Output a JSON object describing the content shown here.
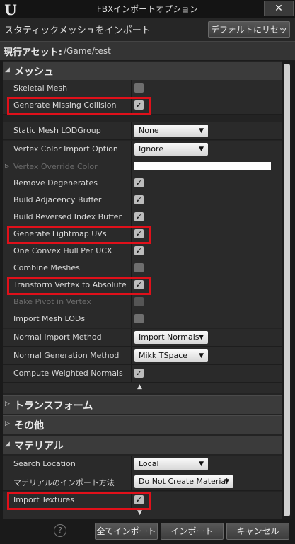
{
  "window": {
    "title": "FBXインポートオプション",
    "close": "✕",
    "logo_icon": "unreal-logo"
  },
  "header": {
    "title": "スタティックメッシュをインポート",
    "reset_label": "デフォルトにリセット"
  },
  "path": {
    "label": "現行アセット:",
    "value": "/Game/test"
  },
  "sections": {
    "mesh": "メッシュ",
    "transform": "トランスフォーム",
    "misc": "その他",
    "material": "マテリアル"
  },
  "mesh_rows": {
    "skeletal_mesh": {
      "label": "Skeletal Mesh",
      "checked": false
    },
    "generate_missing_collision": {
      "label": "Generate Missing Collision",
      "checked": true
    },
    "static_mesh_lodgroup": {
      "label": "Static Mesh LODGroup",
      "value": "None"
    },
    "vertex_color_import_option": {
      "label": "Vertex Color Import Option",
      "value": "Ignore"
    },
    "vertex_override_color": {
      "label": "Vertex Override Color",
      "color": "#ffffff"
    },
    "remove_degenerates": {
      "label": "Remove Degenerates",
      "checked": true
    },
    "build_adjacency_buffer": {
      "label": "Build Adjacency Buffer",
      "checked": true
    },
    "build_reversed_index_buffer": {
      "label": "Build Reversed Index Buffer",
      "checked": true
    },
    "generate_lightmap_uvs": {
      "label": "Generate Lightmap UVs",
      "checked": true
    },
    "one_convex_hull_per_ucx": {
      "label": "One Convex Hull Per UCX",
      "checked": true
    },
    "combine_meshes": {
      "label": "Combine Meshes",
      "checked": false
    },
    "transform_vertex_to_absolute": {
      "label": "Transform Vertex to Absolute",
      "checked": true
    },
    "bake_pivot_in_vertex": {
      "label": "Bake Pivot in Vertex",
      "checked": false
    },
    "import_mesh_lods": {
      "label": "Import Mesh LODs",
      "checked": false
    },
    "normal_import_method": {
      "label": "Normal Import Method",
      "value": "Import Normals"
    },
    "normal_generation_method": {
      "label": "Normal Generation Method",
      "value": "Mikk TSpace"
    },
    "compute_weighted_normals": {
      "label": "Compute Weighted Normals",
      "checked": true
    }
  },
  "material_rows": {
    "search_location": {
      "label": "Search Location",
      "value": "Local"
    },
    "material_import_method": {
      "label": "マテリアルのインポート方法",
      "value": "Do Not Create Material"
    },
    "import_textures": {
      "label": "Import Textures",
      "checked": true
    }
  },
  "footer": {
    "help_icon": "?",
    "import_all": "全てインポート",
    "import": "インポート",
    "cancel": "キャンセル"
  },
  "highlight_color": "#e0101a"
}
